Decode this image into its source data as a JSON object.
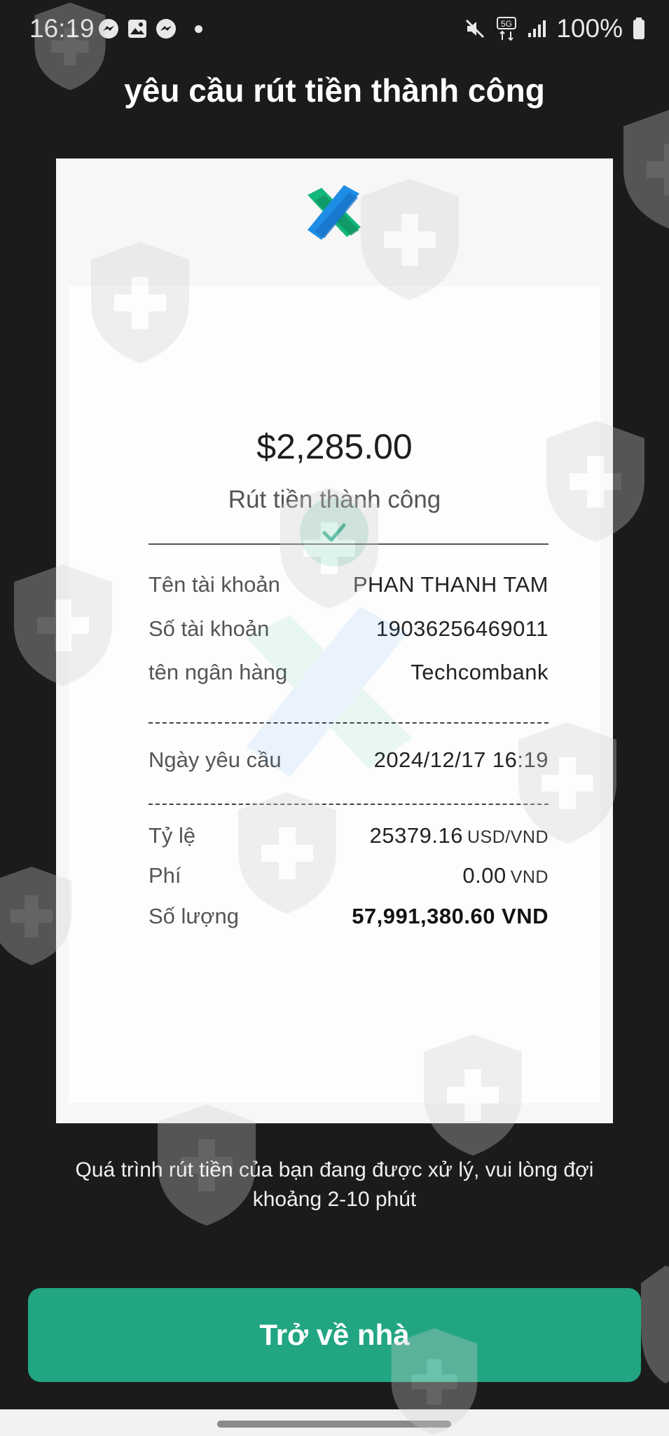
{
  "status_bar": {
    "time": "16:19",
    "battery": "100%",
    "icons_left": [
      "messenger-icon",
      "gallery-icon",
      "messenger-icon",
      "dot"
    ],
    "icons_right": [
      "mute-icon",
      "5g-icon",
      "signal-icon",
      "battery-icon"
    ]
  },
  "page": {
    "title": "yêu cầu rút tiền thành công"
  },
  "receipt": {
    "amount": "$2,285.00",
    "status": "Rút tiền thành công",
    "account_name_label": "Tên tài khoản",
    "account_name_value": "PHAN THANH TAM",
    "account_number_label": "Số tài khoản",
    "account_number_value": "19036256469011",
    "bank_label": "tên ngân hàng",
    "bank_value": "Techcombank",
    "date_label": "Ngày yêu cầu",
    "date_value": "2024/12/17 16:19",
    "rate_label": "Tỷ lệ",
    "rate_value": "25379.16",
    "rate_unit": "USD/VND",
    "fee_label": "Phí",
    "fee_value": "0.00",
    "fee_unit": "VND",
    "quantity_label": "Số lượng",
    "quantity_value": "57,991,380.60 VND"
  },
  "note": "Quá trình rút tiền của bạn đang được xử lý, vui lòng đợi khoảng 2-10 phút",
  "home_button": "Trở về nhà",
  "colors": {
    "background": "#1b1b1b",
    "accent": "#22a583",
    "check_bg": "#cfeee2"
  }
}
